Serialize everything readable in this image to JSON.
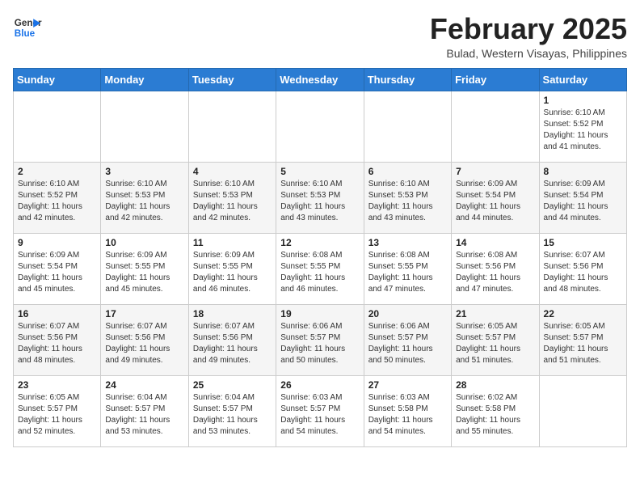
{
  "header": {
    "logo_line1": "General",
    "logo_line2": "Blue",
    "month_year": "February 2025",
    "location": "Bulad, Western Visayas, Philippines"
  },
  "weekdays": [
    "Sunday",
    "Monday",
    "Tuesday",
    "Wednesday",
    "Thursday",
    "Friday",
    "Saturday"
  ],
  "weeks": [
    [
      {
        "day": "",
        "info": ""
      },
      {
        "day": "",
        "info": ""
      },
      {
        "day": "",
        "info": ""
      },
      {
        "day": "",
        "info": ""
      },
      {
        "day": "",
        "info": ""
      },
      {
        "day": "",
        "info": ""
      },
      {
        "day": "1",
        "info": "Sunrise: 6:10 AM\nSunset: 5:52 PM\nDaylight: 11 hours and 41 minutes."
      }
    ],
    [
      {
        "day": "2",
        "info": "Sunrise: 6:10 AM\nSunset: 5:52 PM\nDaylight: 11 hours and 42 minutes."
      },
      {
        "day": "3",
        "info": "Sunrise: 6:10 AM\nSunset: 5:53 PM\nDaylight: 11 hours and 42 minutes."
      },
      {
        "day": "4",
        "info": "Sunrise: 6:10 AM\nSunset: 5:53 PM\nDaylight: 11 hours and 42 minutes."
      },
      {
        "day": "5",
        "info": "Sunrise: 6:10 AM\nSunset: 5:53 PM\nDaylight: 11 hours and 43 minutes."
      },
      {
        "day": "6",
        "info": "Sunrise: 6:10 AM\nSunset: 5:53 PM\nDaylight: 11 hours and 43 minutes."
      },
      {
        "day": "7",
        "info": "Sunrise: 6:09 AM\nSunset: 5:54 PM\nDaylight: 11 hours and 44 minutes."
      },
      {
        "day": "8",
        "info": "Sunrise: 6:09 AM\nSunset: 5:54 PM\nDaylight: 11 hours and 44 minutes."
      }
    ],
    [
      {
        "day": "9",
        "info": "Sunrise: 6:09 AM\nSunset: 5:54 PM\nDaylight: 11 hours and 45 minutes."
      },
      {
        "day": "10",
        "info": "Sunrise: 6:09 AM\nSunset: 5:55 PM\nDaylight: 11 hours and 45 minutes."
      },
      {
        "day": "11",
        "info": "Sunrise: 6:09 AM\nSunset: 5:55 PM\nDaylight: 11 hours and 46 minutes."
      },
      {
        "day": "12",
        "info": "Sunrise: 6:08 AM\nSunset: 5:55 PM\nDaylight: 11 hours and 46 minutes."
      },
      {
        "day": "13",
        "info": "Sunrise: 6:08 AM\nSunset: 5:55 PM\nDaylight: 11 hours and 47 minutes."
      },
      {
        "day": "14",
        "info": "Sunrise: 6:08 AM\nSunset: 5:56 PM\nDaylight: 11 hours and 47 minutes."
      },
      {
        "day": "15",
        "info": "Sunrise: 6:07 AM\nSunset: 5:56 PM\nDaylight: 11 hours and 48 minutes."
      }
    ],
    [
      {
        "day": "16",
        "info": "Sunrise: 6:07 AM\nSunset: 5:56 PM\nDaylight: 11 hours and 48 minutes."
      },
      {
        "day": "17",
        "info": "Sunrise: 6:07 AM\nSunset: 5:56 PM\nDaylight: 11 hours and 49 minutes."
      },
      {
        "day": "18",
        "info": "Sunrise: 6:07 AM\nSunset: 5:56 PM\nDaylight: 11 hours and 49 minutes."
      },
      {
        "day": "19",
        "info": "Sunrise: 6:06 AM\nSunset: 5:57 PM\nDaylight: 11 hours and 50 minutes."
      },
      {
        "day": "20",
        "info": "Sunrise: 6:06 AM\nSunset: 5:57 PM\nDaylight: 11 hours and 50 minutes."
      },
      {
        "day": "21",
        "info": "Sunrise: 6:05 AM\nSunset: 5:57 PM\nDaylight: 11 hours and 51 minutes."
      },
      {
        "day": "22",
        "info": "Sunrise: 6:05 AM\nSunset: 5:57 PM\nDaylight: 11 hours and 51 minutes."
      }
    ],
    [
      {
        "day": "23",
        "info": "Sunrise: 6:05 AM\nSunset: 5:57 PM\nDaylight: 11 hours and 52 minutes."
      },
      {
        "day": "24",
        "info": "Sunrise: 6:04 AM\nSunset: 5:57 PM\nDaylight: 11 hours and 53 minutes."
      },
      {
        "day": "25",
        "info": "Sunrise: 6:04 AM\nSunset: 5:57 PM\nDaylight: 11 hours and 53 minutes."
      },
      {
        "day": "26",
        "info": "Sunrise: 6:03 AM\nSunset: 5:57 PM\nDaylight: 11 hours and 54 minutes."
      },
      {
        "day": "27",
        "info": "Sunrise: 6:03 AM\nSunset: 5:58 PM\nDaylight: 11 hours and 54 minutes."
      },
      {
        "day": "28",
        "info": "Sunrise: 6:02 AM\nSunset: 5:58 PM\nDaylight: 11 hours and 55 minutes."
      },
      {
        "day": "",
        "info": ""
      }
    ]
  ]
}
